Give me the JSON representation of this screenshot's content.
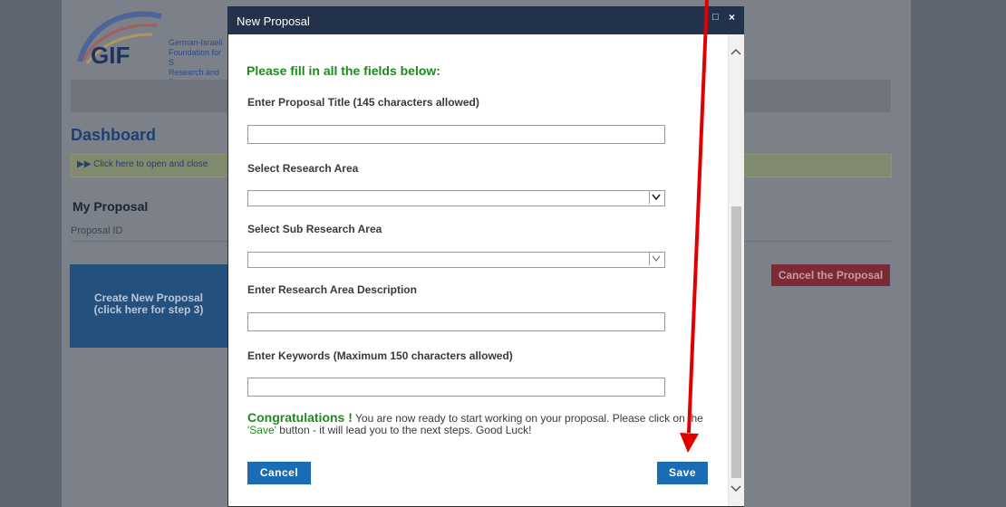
{
  "background": {
    "logo": {
      "text": "GIF",
      "line1": "German-Israeli",
      "line2": "Foundation for S",
      "line3": "Research and De"
    },
    "dashboard_title": "Dashboard",
    "toggle_text": "▶▶ Click here to open and close",
    "my_proposal": "My Proposal",
    "proposal_id_label": "Proposal ID",
    "create_new_line1": "Create New Proposal",
    "create_new_line2": "(click here for step 3)",
    "cancel_proposal": "Cancel the Proposal"
  },
  "modal": {
    "title": "New Proposal",
    "maximize_glyph": "□",
    "close_glyph": "×",
    "heading": "Please fill in all the fields below:",
    "fields": {
      "title_label": "Enter Proposal Title (145 characters allowed)",
      "title_value": "",
      "research_area_label": "Select Research Area",
      "research_area_value": "",
      "sub_area_label": "Select Sub Research Area",
      "sub_area_value": "",
      "description_label": "Enter Research Area Description",
      "description_value": "",
      "keywords_label": "Enter Keywords (Maximum 150 characters allowed)",
      "keywords_value": ""
    },
    "congrats": {
      "word": "Congratulations",
      "bang": " !",
      "text1": " You are now ready to start working on your proposal. Please click on the ",
      "save_quote": "'Save'",
      "text2": " button - it will lead you to the next steps. Good Luck!"
    },
    "buttons": {
      "cancel": "Cancel",
      "save": "Save"
    }
  },
  "colors": {
    "accent_blue": "#1a6cb5",
    "heading_green": "#1e8a1e",
    "annotation_red": "#e00000"
  }
}
